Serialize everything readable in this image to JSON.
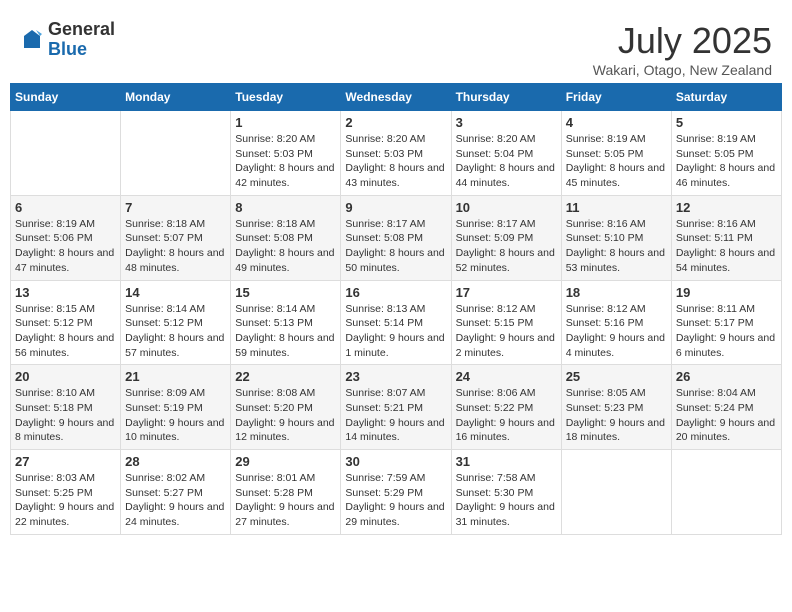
{
  "logo": {
    "general": "General",
    "blue": "Blue"
  },
  "title": {
    "month": "July 2025",
    "location": "Wakari, Otago, New Zealand"
  },
  "weekdays": [
    "Sunday",
    "Monday",
    "Tuesday",
    "Wednesday",
    "Thursday",
    "Friday",
    "Saturday"
  ],
  "weeks": [
    [
      {
        "day": null
      },
      {
        "day": null
      },
      {
        "day": "1",
        "sunrise": "Sunrise: 8:20 AM",
        "sunset": "Sunset: 5:03 PM",
        "daylight": "Daylight: 8 hours and 42 minutes."
      },
      {
        "day": "2",
        "sunrise": "Sunrise: 8:20 AM",
        "sunset": "Sunset: 5:03 PM",
        "daylight": "Daylight: 8 hours and 43 minutes."
      },
      {
        "day": "3",
        "sunrise": "Sunrise: 8:20 AM",
        "sunset": "Sunset: 5:04 PM",
        "daylight": "Daylight: 8 hours and 44 minutes."
      },
      {
        "day": "4",
        "sunrise": "Sunrise: 8:19 AM",
        "sunset": "Sunset: 5:05 PM",
        "daylight": "Daylight: 8 hours and 45 minutes."
      },
      {
        "day": "5",
        "sunrise": "Sunrise: 8:19 AM",
        "sunset": "Sunset: 5:05 PM",
        "daylight": "Daylight: 8 hours and 46 minutes."
      }
    ],
    [
      {
        "day": "6",
        "sunrise": "Sunrise: 8:19 AM",
        "sunset": "Sunset: 5:06 PM",
        "daylight": "Daylight: 8 hours and 47 minutes."
      },
      {
        "day": "7",
        "sunrise": "Sunrise: 8:18 AM",
        "sunset": "Sunset: 5:07 PM",
        "daylight": "Daylight: 8 hours and 48 minutes."
      },
      {
        "day": "8",
        "sunrise": "Sunrise: 8:18 AM",
        "sunset": "Sunset: 5:08 PM",
        "daylight": "Daylight: 8 hours and 49 minutes."
      },
      {
        "day": "9",
        "sunrise": "Sunrise: 8:17 AM",
        "sunset": "Sunset: 5:08 PM",
        "daylight": "Daylight: 8 hours and 50 minutes."
      },
      {
        "day": "10",
        "sunrise": "Sunrise: 8:17 AM",
        "sunset": "Sunset: 5:09 PM",
        "daylight": "Daylight: 8 hours and 52 minutes."
      },
      {
        "day": "11",
        "sunrise": "Sunrise: 8:16 AM",
        "sunset": "Sunset: 5:10 PM",
        "daylight": "Daylight: 8 hours and 53 minutes."
      },
      {
        "day": "12",
        "sunrise": "Sunrise: 8:16 AM",
        "sunset": "Sunset: 5:11 PM",
        "daylight": "Daylight: 8 hours and 54 minutes."
      }
    ],
    [
      {
        "day": "13",
        "sunrise": "Sunrise: 8:15 AM",
        "sunset": "Sunset: 5:12 PM",
        "daylight": "Daylight: 8 hours and 56 minutes."
      },
      {
        "day": "14",
        "sunrise": "Sunrise: 8:14 AM",
        "sunset": "Sunset: 5:12 PM",
        "daylight": "Daylight: 8 hours and 57 minutes."
      },
      {
        "day": "15",
        "sunrise": "Sunrise: 8:14 AM",
        "sunset": "Sunset: 5:13 PM",
        "daylight": "Daylight: 8 hours and 59 minutes."
      },
      {
        "day": "16",
        "sunrise": "Sunrise: 8:13 AM",
        "sunset": "Sunset: 5:14 PM",
        "daylight": "Daylight: 9 hours and 1 minute."
      },
      {
        "day": "17",
        "sunrise": "Sunrise: 8:12 AM",
        "sunset": "Sunset: 5:15 PM",
        "daylight": "Daylight: 9 hours and 2 minutes."
      },
      {
        "day": "18",
        "sunrise": "Sunrise: 8:12 AM",
        "sunset": "Sunset: 5:16 PM",
        "daylight": "Daylight: 9 hours and 4 minutes."
      },
      {
        "day": "19",
        "sunrise": "Sunrise: 8:11 AM",
        "sunset": "Sunset: 5:17 PM",
        "daylight": "Daylight: 9 hours and 6 minutes."
      }
    ],
    [
      {
        "day": "20",
        "sunrise": "Sunrise: 8:10 AM",
        "sunset": "Sunset: 5:18 PM",
        "daylight": "Daylight: 9 hours and 8 minutes."
      },
      {
        "day": "21",
        "sunrise": "Sunrise: 8:09 AM",
        "sunset": "Sunset: 5:19 PM",
        "daylight": "Daylight: 9 hours and 10 minutes."
      },
      {
        "day": "22",
        "sunrise": "Sunrise: 8:08 AM",
        "sunset": "Sunset: 5:20 PM",
        "daylight": "Daylight: 9 hours and 12 minutes."
      },
      {
        "day": "23",
        "sunrise": "Sunrise: 8:07 AM",
        "sunset": "Sunset: 5:21 PM",
        "daylight": "Daylight: 9 hours and 14 minutes."
      },
      {
        "day": "24",
        "sunrise": "Sunrise: 8:06 AM",
        "sunset": "Sunset: 5:22 PM",
        "daylight": "Daylight: 9 hours and 16 minutes."
      },
      {
        "day": "25",
        "sunrise": "Sunrise: 8:05 AM",
        "sunset": "Sunset: 5:23 PM",
        "daylight": "Daylight: 9 hours and 18 minutes."
      },
      {
        "day": "26",
        "sunrise": "Sunrise: 8:04 AM",
        "sunset": "Sunset: 5:24 PM",
        "daylight": "Daylight: 9 hours and 20 minutes."
      }
    ],
    [
      {
        "day": "27",
        "sunrise": "Sunrise: 8:03 AM",
        "sunset": "Sunset: 5:25 PM",
        "daylight": "Daylight: 9 hours and 22 minutes."
      },
      {
        "day": "28",
        "sunrise": "Sunrise: 8:02 AM",
        "sunset": "Sunset: 5:27 PM",
        "daylight": "Daylight: 9 hours and 24 minutes."
      },
      {
        "day": "29",
        "sunrise": "Sunrise: 8:01 AM",
        "sunset": "Sunset: 5:28 PM",
        "daylight": "Daylight: 9 hours and 27 minutes."
      },
      {
        "day": "30",
        "sunrise": "Sunrise: 7:59 AM",
        "sunset": "Sunset: 5:29 PM",
        "daylight": "Daylight: 9 hours and 29 minutes."
      },
      {
        "day": "31",
        "sunrise": "Sunrise: 7:58 AM",
        "sunset": "Sunset: 5:30 PM",
        "daylight": "Daylight: 9 hours and 31 minutes."
      },
      {
        "day": null
      },
      {
        "day": null
      }
    ]
  ]
}
